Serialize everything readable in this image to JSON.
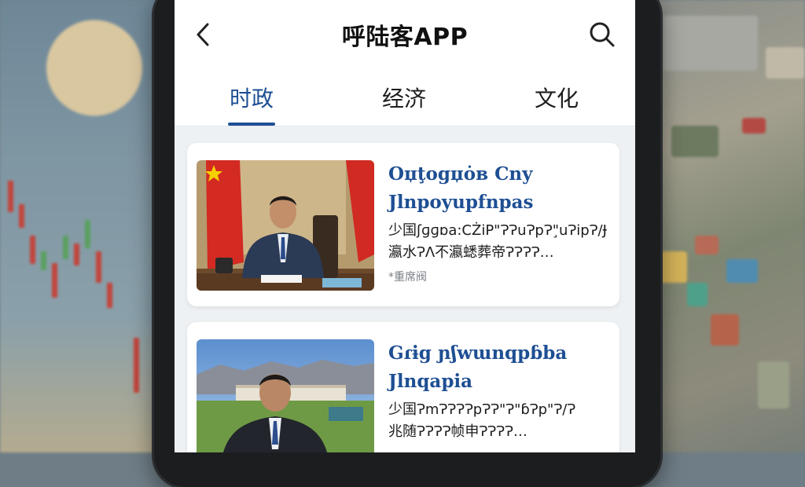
{
  "app": {
    "title": "呼陆客APP"
  },
  "header": {
    "back_icon": "back-arrow-icon",
    "search_icon": "search-icon"
  },
  "tabs": [
    {
      "label": "时政",
      "active": true
    },
    {
      "label": "经济",
      "active": false
    },
    {
      "label": "文化",
      "active": false
    }
  ],
  "articles": [
    {
      "headline_line1": "Oџţogџȯʙ Cny",
      "headline_line2": "Jlnpoyupfnpas",
      "summary_line1": "少国ʃɡɡɒa:CŻiP\"ɁɁuɁpɁ\"̧uɁipɁ/Ɉ",
      "summary_line2": "瀛水ɁɅ不瀛蟋葬帝ɁɁɁɁ…",
      "source": "*重席阀",
      "image": "official-at-desk-with-flags"
    },
    {
      "headline_line1": "Gɾɨg ɲʃwɯnqpɓba",
      "headline_line2": "Jlnqapia",
      "summary_line1": "少国ɁmɁɁɁɁpɁɁ\"Ɂ\"ɓɁp\"Ɂ/Ɂ",
      "summary_line2": "兆随ɁɁɁɁ帧申ɁɁɁɁ…",
      "source": "",
      "image": "official-outdoors-with-mountains"
    }
  ],
  "colors": {
    "accent": "#1e4f93",
    "screen_bg": "#eef1f4"
  }
}
